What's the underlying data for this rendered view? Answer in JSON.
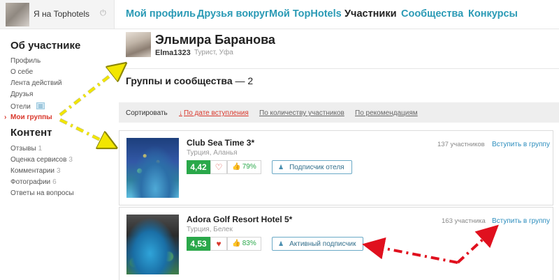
{
  "me": {
    "label": "Я на Tophotels",
    "icons": {
      "avatar": "avatar",
      "power": "power-icon"
    }
  },
  "topnav": {
    "items": [
      {
        "label": "Мой профиль",
        "active": false
      },
      {
        "label": "Друзья вокруг",
        "active": false
      },
      {
        "label": "Мой TopHotels",
        "active": false
      },
      {
        "label": "Участники",
        "active": true
      },
      {
        "label": "Сообщества",
        "active": false
      },
      {
        "label": "Конкурсы",
        "active": false
      }
    ]
  },
  "sidebar": {
    "section1_title": "Об участнике",
    "section1_items": [
      {
        "label": "Профиль"
      },
      {
        "label": "О себе"
      },
      {
        "label": "Лента действий"
      },
      {
        "label": "Друзья"
      },
      {
        "label": "Отели",
        "icon": "hotel-list-icon"
      },
      {
        "label": "Мои группы",
        "current": true
      }
    ],
    "section2_title": "Контент",
    "section2_items": [
      {
        "label": "Отзывы",
        "count": "1"
      },
      {
        "label": "Оценка сервисов",
        "count": "3"
      },
      {
        "label": "Комментарии",
        "count": "3"
      },
      {
        "label": "Фотографии",
        "count": "6"
      },
      {
        "label": "Ответы на вопросы",
        "count": ""
      }
    ]
  },
  "profile": {
    "name": "Эльмира Баранова",
    "login": "Elma1323",
    "meta": "Турист, Уфа"
  },
  "groups": {
    "title": "Группы и сообщества",
    "dash": "—",
    "count": "2"
  },
  "sort": {
    "label": "Сортировать",
    "options": [
      {
        "label": "По дате вступления",
        "active": true,
        "arrow": "↓"
      },
      {
        "label": "По количеству участников",
        "active": false
      },
      {
        "label": "По рекомендациям",
        "active": false
      }
    ]
  },
  "cards": [
    {
      "title": "Club Sea Time 3*",
      "location": "Турция, Аланья",
      "rating": "4,42",
      "liked": false,
      "recommend": "79%",
      "subscription": "Подписчик отеля",
      "members": "137 участников",
      "join": "Вступить в группу"
    },
    {
      "title": "Adora Golf Resort Hotel 5*",
      "location": "Турция, Белек",
      "rating": "4,53",
      "liked": true,
      "recommend": "83%",
      "subscription": "Активный подписчик",
      "members": "163 участника",
      "join": "Вступить в группу"
    }
  ],
  "colors": {
    "accent": "#2a9ab5",
    "current": "#d9372b",
    "rating_bg": "#2aa84a",
    "arrow_yellow": "#f2e600",
    "arrow_red": "#e0101e"
  }
}
